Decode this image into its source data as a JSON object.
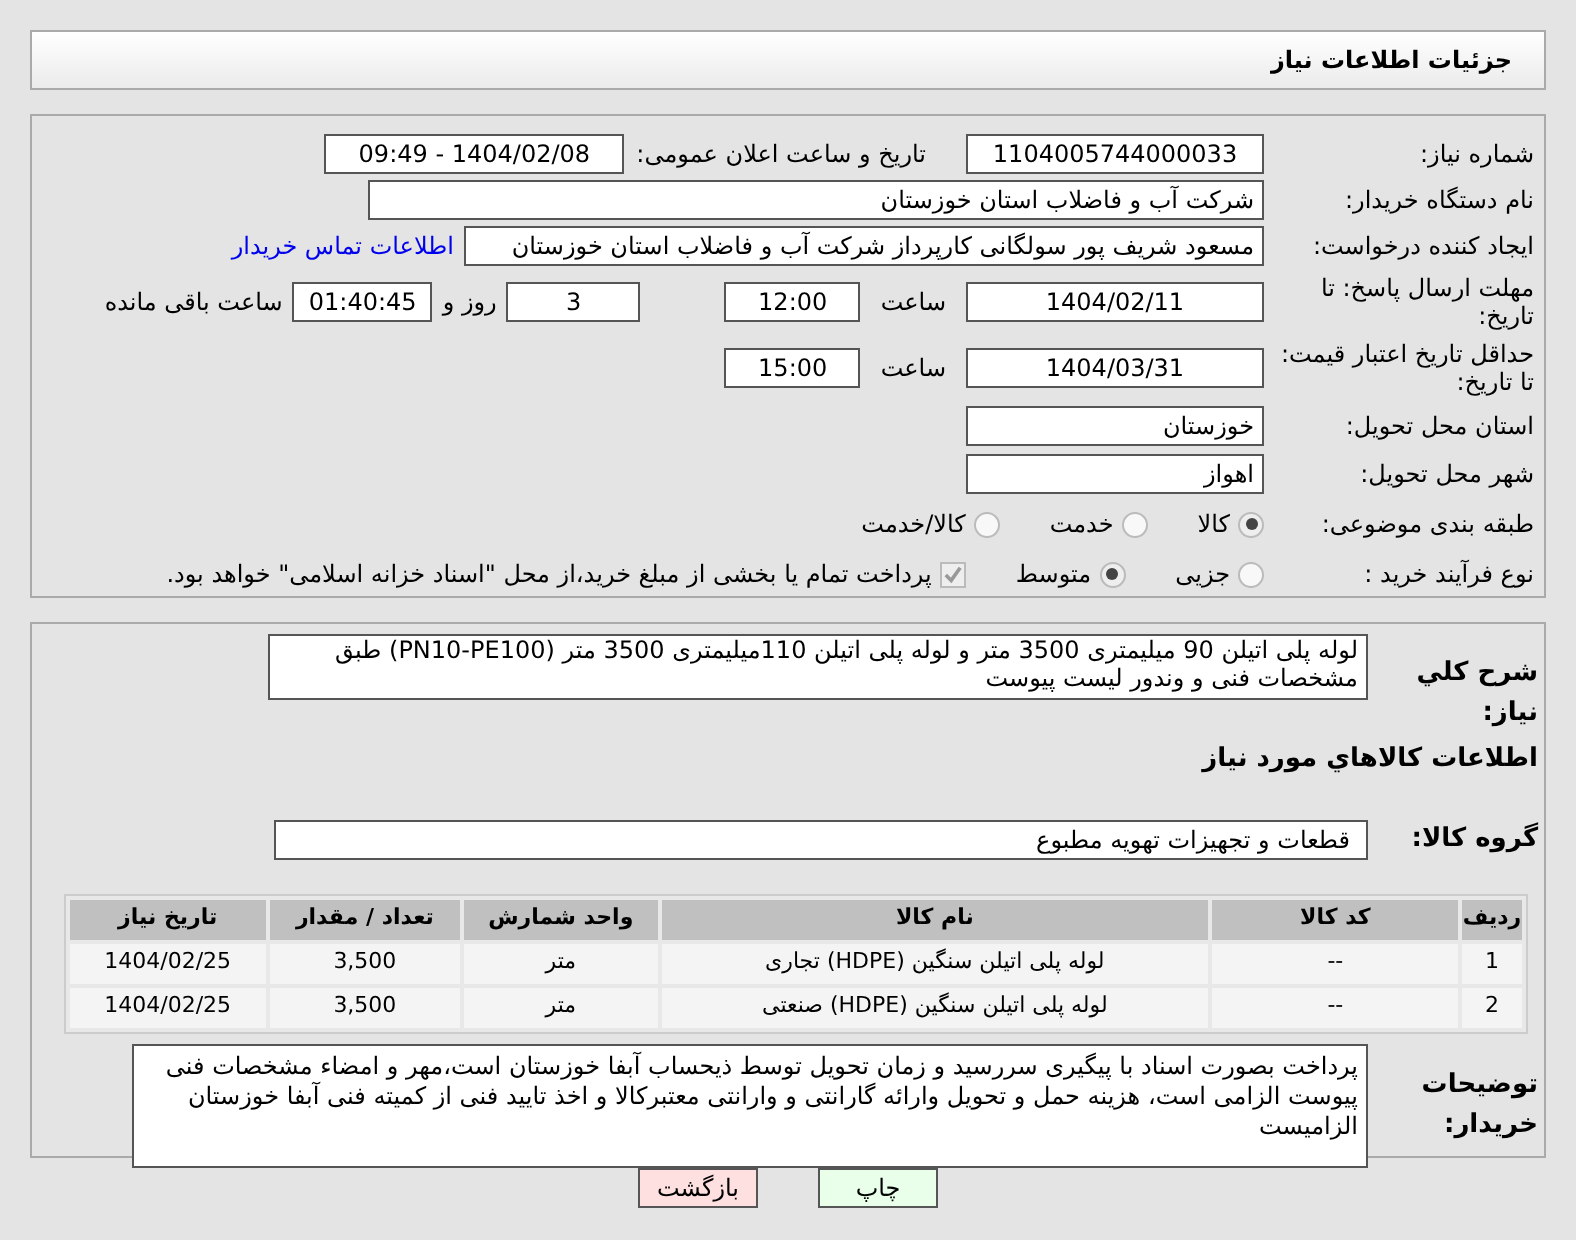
{
  "header": {
    "title": "جزئیات اطلاعات نیاز"
  },
  "fields": {
    "need_number": {
      "label": "شماره نیاز:",
      "value": "1104005744000033"
    },
    "announce": {
      "label": "تاریخ و ساعت اعلان عمومی:",
      "value": "1404/02/08 - 09:49"
    },
    "buyer": {
      "label": "نام دستگاه خریدار:",
      "value": "شرکت آب و فاضلاب استان خوزستان"
    },
    "creator": {
      "label": "ایجاد کننده درخواست:",
      "value": "مسعود شریف پور سولگانی کارپرداز شرکت آب و فاضلاب استان خوزستان",
      "link": "اطلاعات تماس خریدار"
    },
    "deadline": {
      "label": "مهلت ارسال پاسخ: تا تاریخ:",
      "date": "1404/02/11",
      "time_label": "ساعت",
      "time": "12:00",
      "days": "3",
      "days_label": "روز و",
      "remaining": "01:40:45",
      "remaining_label": "ساعت باقی مانده"
    },
    "validity": {
      "label": "حداقل تاریخ اعتبار قیمت: تا تاریخ:",
      "date": "1404/03/31",
      "time_label": "ساعت",
      "time": "15:00"
    },
    "province": {
      "label": "استان محل تحویل:",
      "value": "خوزستان"
    },
    "city": {
      "label": "شهر محل تحویل:",
      "value": "اهواز"
    }
  },
  "category": {
    "label": "طبقه بندی موضوعی:",
    "options": [
      {
        "label": "کالا",
        "selected": true
      },
      {
        "label": "خدمت",
        "selected": false
      },
      {
        "label": "کالا/خدمت",
        "selected": false
      }
    ]
  },
  "process": {
    "label": "نوع فرآیند خرید :",
    "options": [
      {
        "label": "جزیی",
        "selected": false
      },
      {
        "label": "متوسط",
        "selected": true
      }
    ],
    "treasury": {
      "label": "پرداخت تمام یا بخشی از مبلغ خرید،از محل \"اسناد خزانه اسلامی\" خواهد بود.",
      "checked": true
    }
  },
  "description": {
    "label": "شرح كلي نياز:",
    "value": "لوله پلی اتیلن 90 میلیمتری 3500 متر و لوله پلی اتیلن 110میلیمتری 3500 متر (PN10-PE100)  طبق مشخصات فنی و وندور لیست پیوست"
  },
  "goods_heading": "اطلاعات كالاهاي مورد نياز",
  "goods_group": {
    "label": "گروه کالا:",
    "value": "قطعات و تجهیزات تهویه مطبوع"
  },
  "table": {
    "columns": [
      "ردیف",
      "کد کالا",
      "نام کالا",
      "واحد شمارش",
      "تعداد / مقدار",
      "تاریخ نیاز"
    ],
    "rows": [
      [
        "1",
        "--",
        "لوله پلی اتیلن سنگین (HDPE) تجاری",
        "متر",
        "3,500",
        "1404/02/25"
      ],
      [
        "2",
        "--",
        "لوله پلی اتیلن سنگین (HDPE) صنعتی",
        "متر",
        "3,500",
        "1404/02/25"
      ]
    ]
  },
  "buyer_notes": {
    "label": "توضیحات خریدار:",
    "value": "پرداخت بصورت اسناد با پیگیری  سررسید و زمان تحویل توسط ذیحساب آبفا خوزستان است،مهر و امضاء مشخصات فنی پیوست الزامی است، هزینه حمل و تحویل وارائه گارانتی و وارانتی معتبرکالا و اخذ تایید فنی از کمیته فنی آبفا خوزستان الزامیست"
  },
  "buttons": [
    {
      "label": "چاپ",
      "kind": "print"
    },
    {
      "label": "بازگشت",
      "kind": "back"
    }
  ]
}
